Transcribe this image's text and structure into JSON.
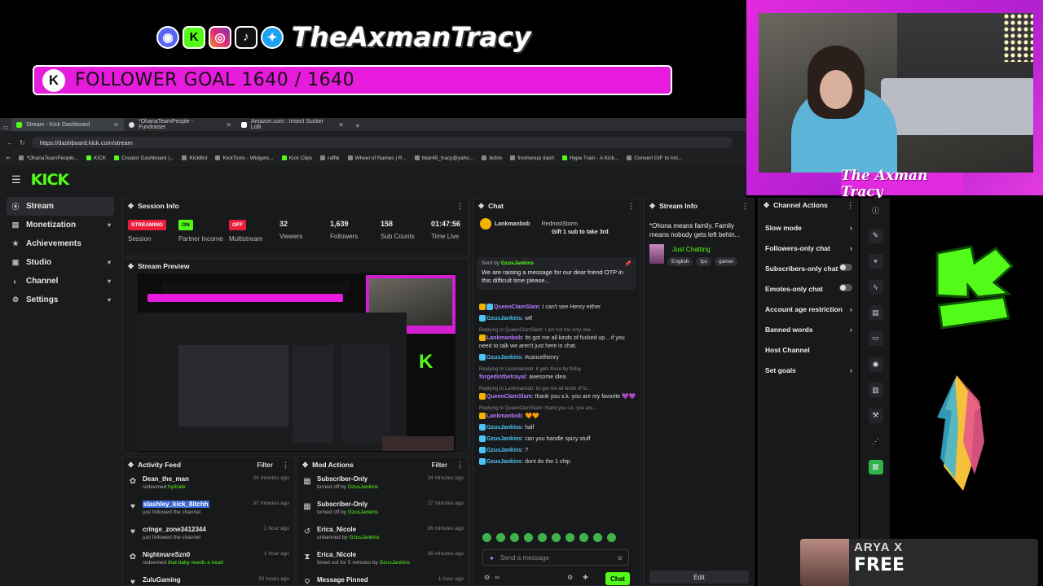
{
  "overlay": {
    "streamer_name": "TheAxmanTracy",
    "follower_goal": "FOLLOWER GOAL 1640 / 1640",
    "kick_badge": "K",
    "cam_name": "The Axman Tracy",
    "promo_name": "ARYA X",
    "promo_label": "FREE"
  },
  "browser": {
    "tabs": [
      {
        "label": "Stream - Kick Dashboard"
      },
      {
        "label": "*OhanaTeamPeople - Fundraiser"
      },
      {
        "label": "Amazon.com : Insect Sucker Lolli"
      }
    ],
    "url": "https://dashboard.kick.com/stream",
    "bookmarks": [
      "*OhanaTeamPeople...",
      "KICK",
      "Creator Dashboard |...",
      "KickBot",
      "KickTools - Widgets...",
      "Kick Clips",
      "raffle",
      "Wheel of Names | R...",
      "blair45_tracy@yaho...",
      "botrix",
      "freshenup dash",
      "Hype Train - A Kick...",
      "Convert GIF to Ani..."
    ]
  },
  "kick": {
    "logo": "KICK",
    "sidebar": [
      {
        "label": "Stream",
        "icon": "stream-icon",
        "chev": ""
      },
      {
        "label": "Monetization",
        "icon": "wallet-icon",
        "chev": "▾"
      },
      {
        "label": "Achievements",
        "icon": "trophy-icon",
        "chev": ""
      },
      {
        "label": "Studio",
        "icon": "studio-icon",
        "chev": "▾"
      },
      {
        "label": "Channel",
        "icon": "channel-icon",
        "chev": "▾"
      },
      {
        "label": "Settings",
        "icon": "gear-icon",
        "chev": "▾"
      }
    ],
    "session": {
      "title": "Session Info",
      "stats": [
        {
          "value": "STREAMING",
          "label": "Session",
          "type": "red"
        },
        {
          "value": "ON",
          "label": "Partner Income",
          "type": "green"
        },
        {
          "value": "OFF",
          "label": "Multistream",
          "type": "red"
        },
        {
          "value": "32",
          "label": "Viewers",
          "type": "num"
        },
        {
          "value": "1,639",
          "label": "Followers",
          "type": "num"
        },
        {
          "value": "158",
          "label": "Sub Counts",
          "type": "num"
        },
        {
          "value": "01:47:56",
          "label": "Time Live",
          "type": "num"
        }
      ]
    },
    "preview": {
      "title": "Stream Preview"
    },
    "activity": {
      "title": "Activity Feed",
      "filter": "Filter",
      "items": [
        {
          "user": "Dean_the_man",
          "action": "redeemed",
          "detail": "hydrate",
          "time": "24 minutes ago",
          "icon": "redeem-icon"
        },
        {
          "user": "slashley_kick_8itchh",
          "action": "just followed the channel",
          "detail": "",
          "time": "37 minutes ago",
          "icon": "heart-icon"
        },
        {
          "user": "cringe_zone3412344",
          "action": "just followed the channel",
          "detail": "",
          "time": "1 hour ago",
          "icon": "heart-icon"
        },
        {
          "user": "NightmareSzn0",
          "action": "redeemed",
          "detail": "that baby needs a treat!",
          "time": "1 hour ago",
          "icon": "redeem-icon"
        },
        {
          "user": "ZuluGaming",
          "action": "",
          "detail": "",
          "time": "20 hours ago",
          "icon": "heart-icon"
        }
      ]
    },
    "mod": {
      "title": "Mod Actions",
      "filter": "Filter",
      "items": [
        {
          "title": "Subscriber-Only",
          "action": "turned off by",
          "by": "GzusJankins",
          "time": "24 minutes ago",
          "icon": "sub-only-icon"
        },
        {
          "title": "Subscriber-Only",
          "action": "turned off by",
          "by": "GzusJankins",
          "time": "27 minutes ago",
          "icon": "sub-only-icon"
        },
        {
          "title": "Erica_Nicole",
          "action": "unbanned by",
          "by": "GzusJankins",
          "time": "26 minutes ago",
          "icon": "unban-icon"
        },
        {
          "title": "Erica_Nicole",
          "action": "timed out for 5 minutes by",
          "by": "GzusJankins",
          "time": "26 minutes ago",
          "icon": "timeout-icon"
        },
        {
          "title": "Message Pinned",
          "action": "",
          "by": "",
          "time": "1 hour ago",
          "icon": "pin-icon"
        }
      ]
    },
    "chat": {
      "title": "Chat",
      "top_user": "Lankmanbob",
      "top_gift_user": "RedmistStorm",
      "top_gift_text": "Gift 1 sub to take 3rd",
      "pinned_by_label": "Sent by",
      "pinned_by": "GzusJankins",
      "pinned_text": "We are raising a message for our dear friend OTP in this difficult time please...",
      "placeholder": "Send a message",
      "chat_button": "Chat",
      "messages": [
        {
          "reply": "",
          "user": "QueenClamSlam",
          "text": "I can't see Henry either",
          "color": "p"
        },
        {
          "reply": "",
          "user": "GzusJankins",
          "text": "wtf",
          "color": ""
        },
        {
          "reply": "Replying to QueenClamSlam: I am not the only one...",
          "user": "Lankmanbob",
          "text": "its got me all kinds of fucked up... if you need to talk we aren't just here in chat.",
          "color": "p"
        },
        {
          "reply": "",
          "user": "GzusJankins",
          "text": "#cancelhenry",
          "color": ""
        },
        {
          "reply": "Replying to Lankmanbob: it gets there by friday",
          "user": "forgedintbetrayal",
          "text": "awesome idea.",
          "color": "p"
        },
        {
          "reply": "Replying to Lankmanbob: its got me all kinds of fu...",
          "user": "QueenClamSlam",
          "text": "thank you s.k. you are my favorite 💜💜",
          "color": "p"
        },
        {
          "reply": "Replying to QueenClamSlam: thank you s.k. you are...",
          "user": "Lankmanbob",
          "text": "🧡🧡",
          "color": "p"
        },
        {
          "reply": "",
          "user": "GzusJankins",
          "text": "half",
          "color": ""
        },
        {
          "reply": "",
          "user": "GzusJankins",
          "text": "can you handle spicy stuff",
          "color": ""
        },
        {
          "reply": "",
          "user": "GzusJankins",
          "text": "?",
          "color": ""
        },
        {
          "reply": "",
          "user": "GzusJankins",
          "text": "dont do the 1 chip",
          "color": ""
        }
      ]
    },
    "stream_info": {
      "title": "Stream Info",
      "stream_title": "*Ohona means family. Family means nobody gets left behin...",
      "category": "Just Chatting",
      "tags": [
        "English",
        "fps",
        "gamer"
      ],
      "edit": "Edit"
    },
    "channel_actions": {
      "title": "Channel Actions",
      "rows": [
        {
          "label": "Slow mode",
          "ctrl": "chevron"
        },
        {
          "label": "Followers-only chat",
          "ctrl": "chevron"
        },
        {
          "label": "Subscribers-only chat",
          "ctrl": "toggle"
        },
        {
          "label": "Emotes-only chat",
          "ctrl": "toggle"
        },
        {
          "label": "Account age restriction",
          "ctrl": "chevron"
        },
        {
          "label": "Banned words",
          "ctrl": "chevron"
        },
        {
          "label": "Host Channel",
          "ctrl": "none"
        },
        {
          "label": "Set goals",
          "ctrl": "chevron"
        }
      ]
    },
    "tools": [
      "info-icon",
      "pencil-icon",
      "crosshair-icon",
      "bolt-icon",
      "page-icon",
      "chat-bubble-icon",
      "radio-icon",
      "id-card-icon",
      "wrench-icon",
      "share-icon",
      "gift-icon"
    ]
  },
  "colors": {
    "kick_green": "#53fc18",
    "magenta": "#e61bdc",
    "chat_blue": "#4fc3f7",
    "chat_purple": "#b57cff",
    "streaming_red": "#e91e3c"
  }
}
